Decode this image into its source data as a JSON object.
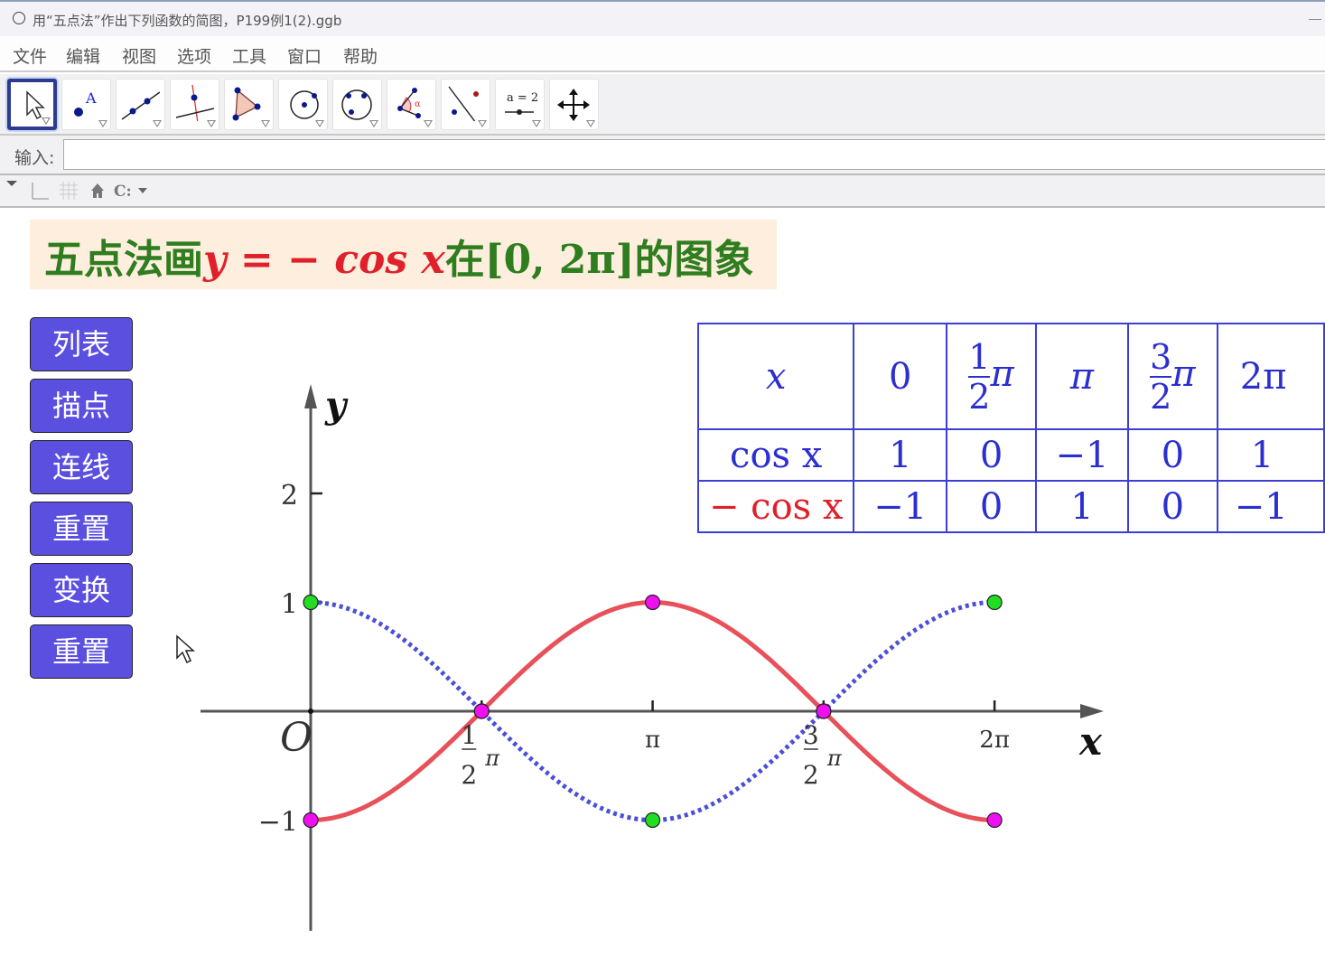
{
  "window": {
    "title": "用“五点法”作出下列函数的简图，P199例1(2).ggb"
  },
  "menu": [
    "文件",
    "编辑",
    "视图",
    "选项",
    "工具",
    "窗口",
    "帮助"
  ],
  "toolbar": {
    "tools": [
      {
        "name": "move-tool",
        "icon": "arrow-cursor-icon"
      },
      {
        "name": "point-tool",
        "icon": "point-icon",
        "label": "A"
      },
      {
        "name": "line-tool",
        "icon": "line-through-points-icon"
      },
      {
        "name": "perpendicular-line-tool",
        "icon": "perpendicular-line-icon"
      },
      {
        "name": "polygon-tool",
        "icon": "polygon-icon"
      },
      {
        "name": "circle-tool",
        "icon": "circle-center-point-icon"
      },
      {
        "name": "conic-tool",
        "icon": "circle-three-points-icon"
      },
      {
        "name": "angle-tool",
        "icon": "angle-icon",
        "label": "α"
      },
      {
        "name": "reflect-tool",
        "icon": "reflect-about-line-icon"
      },
      {
        "name": "slider-tool",
        "icon": "slider-icon",
        "label": "a = 2"
      },
      {
        "name": "move-view-tool",
        "icon": "move-graphics-view-icon"
      }
    ]
  },
  "input_bar": {
    "label": "输入:",
    "value": ""
  },
  "headline": {
    "prefix": "五点法画",
    "func": "y = − cos x",
    "mid": "在[0, 2π]",
    "suffix": "的图象"
  },
  "buttons": [
    "列表",
    "描点",
    "连线",
    "重置",
    "变换",
    "重置"
  ],
  "value_table": {
    "header": {
      "label": "x",
      "cols": [
        "0",
        {
          "num": "1",
          "den": "2",
          "sym": "π"
        },
        "π",
        {
          "num": "3",
          "den": "2",
          "sym": "π"
        },
        "2π"
      ]
    },
    "rows": [
      {
        "label": "cos x",
        "values": [
          "1",
          "0",
          "−1",
          "0",
          "1"
        ]
      },
      {
        "label": "− cos x",
        "values": [
          "−1",
          "0",
          "1",
          "0",
          "−1"
        ]
      }
    ],
    "colors": {
      "text": "#2c2fd0",
      "neg_label": "#e0202a"
    }
  },
  "chart_data": {
    "type": "line",
    "title": "",
    "xlabel": "x",
    "ylabel": "y",
    "origin_label": "O",
    "xlim": [
      -0.64,
      4.6
    ],
    "ylim": [
      -2.0,
      3.0
    ],
    "x_ticks": [
      {
        "value": 1.5708,
        "label": "1/2 π"
      },
      {
        "value": 3.1416,
        "label": "π"
      },
      {
        "value": 4.7124,
        "label": "3/2 π"
      },
      {
        "value": 6.2832,
        "label": "2π"
      }
    ],
    "y_ticks": [
      {
        "value": 2,
        "label": "2"
      },
      {
        "value": 1,
        "label": "1"
      },
      {
        "value": -1,
        "label": "−1"
      }
    ],
    "series": [
      {
        "name": "y = cos x",
        "style": "dotted",
        "color": "#4b4fd8",
        "function": "cos",
        "domain": [
          0,
          6.2832
        ],
        "points": [
          [
            0,
            1
          ],
          [
            1.5708,
            0
          ],
          [
            3.1416,
            -1
          ],
          [
            4.7124,
            0
          ],
          [
            6.2832,
            1
          ]
        ],
        "point_color": "#22dd22"
      },
      {
        "name": "y = −cos x",
        "style": "solid",
        "color": "#e8505a",
        "function": "-cos",
        "domain": [
          0,
          6.2832
        ],
        "points": [
          [
            0,
            -1
          ],
          [
            1.5708,
            0
          ],
          [
            3.1416,
            1
          ],
          [
            4.7124,
            0
          ],
          [
            6.2832,
            -1
          ]
        ],
        "point_color": "#ee10ee"
      }
    ],
    "grid": false
  }
}
